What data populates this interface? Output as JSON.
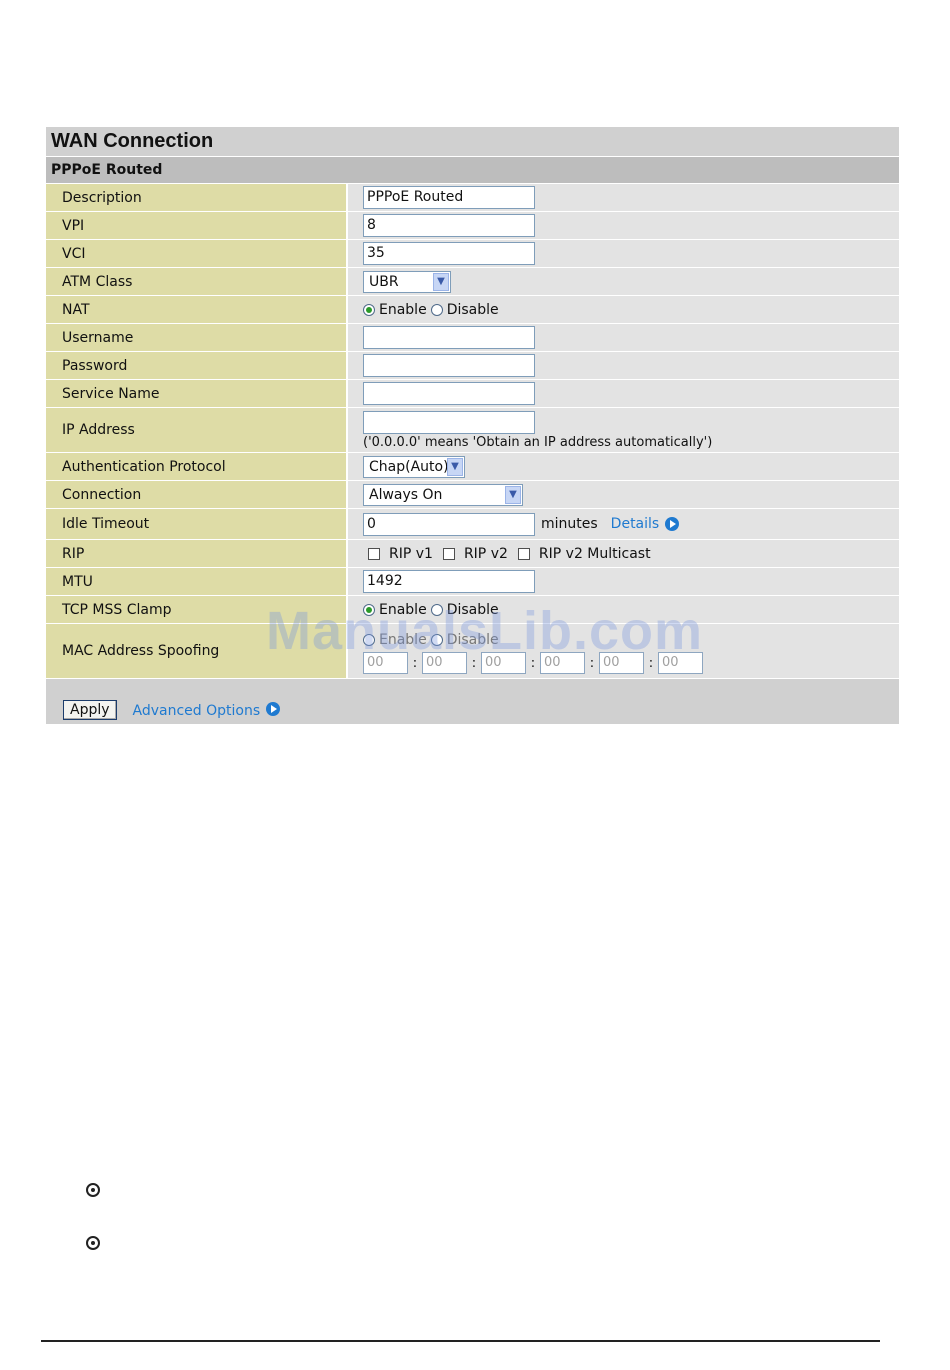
{
  "panel": {
    "title": "WAN Connection",
    "subtitle": "PPPoE Routed"
  },
  "fields": {
    "description": {
      "label": "Description",
      "value": "PPPoE Routed"
    },
    "vpi": {
      "label": "VPI",
      "value": "8"
    },
    "vci": {
      "label": "VCI",
      "value": "35"
    },
    "atm_class": {
      "label": "ATM Class",
      "value": "UBR"
    },
    "nat": {
      "label": "NAT",
      "enable": "Enable",
      "disable": "Disable",
      "selected": "Enable"
    },
    "username": {
      "label": "Username",
      "value": ""
    },
    "password": {
      "label": "Password",
      "value": ""
    },
    "service_name": {
      "label": "Service Name",
      "value": ""
    },
    "ip_address": {
      "label": "IP Address",
      "value": "",
      "hint": "('0.0.0.0' means 'Obtain an IP address automatically')"
    },
    "auth_protocol": {
      "label": "Authentication Protocol",
      "value": "Chap(Auto)"
    },
    "connection": {
      "label": "Connection",
      "value": "Always On"
    },
    "idle_timeout": {
      "label": "Idle Timeout",
      "value": "0",
      "unit": "minutes",
      "details": "Details"
    },
    "rip": {
      "label": "RIP",
      "v1": "RIP v1",
      "v2": "RIP v2",
      "v2m": "RIP v2 Multicast"
    },
    "mtu": {
      "label": "MTU",
      "value": "1492"
    },
    "tcp_mss": {
      "label": "TCP MSS Clamp",
      "enable": "Enable",
      "disable": "Disable",
      "selected": "Enable"
    },
    "mac_spoof": {
      "label": "MAC Address Spoofing",
      "enable": "Enable",
      "disable": "Disable",
      "octets": [
        "00",
        "00",
        "00",
        "00",
        "00",
        "00"
      ],
      "separator": ":"
    }
  },
  "footer": {
    "apply": "Apply",
    "advanced": "Advanced Options"
  },
  "watermark": "ManualsLib.com",
  "colors": {
    "label_bg": "#dedca6",
    "value_bg": "#e3e3e3",
    "header_bg": "#d0d0d0",
    "link": "#1f7ad0"
  },
  "icons": [
    "radio-selected-icon",
    "radio-unselected-icon",
    "checkbox-icon",
    "dropdown-arrow-icon",
    "arrow-circle-icon",
    "bullet-icon"
  ]
}
